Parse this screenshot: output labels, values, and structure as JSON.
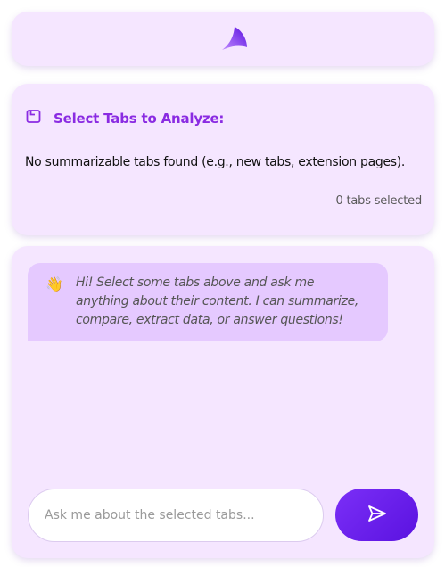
{
  "header": {
    "logo_icon": "horn-logo-icon"
  },
  "tab_selector": {
    "title": "Select Tabs to Analyze:",
    "title_icon": "tab-icon",
    "empty_message": "No summarizable tabs found (e.g., new tabs, extension pages).",
    "selected_count": "0 tabs selected"
  },
  "chat": {
    "welcome_icon": "waving-hand-icon",
    "welcome_emoji": "👋",
    "welcome_message": "Hi! Select some tabs above and ask me anything about their content. I can summarize, compare, extract data, or answer questions!",
    "input_placeholder": "Ask me about the selected tabs...",
    "input_value": "",
    "send_icon": "send-icon"
  },
  "colors": {
    "accent": "#8a2be2",
    "card_background": "#f5e6ff",
    "bubble_background": "#e5c9ff",
    "send_button": "#6a1ff0"
  }
}
